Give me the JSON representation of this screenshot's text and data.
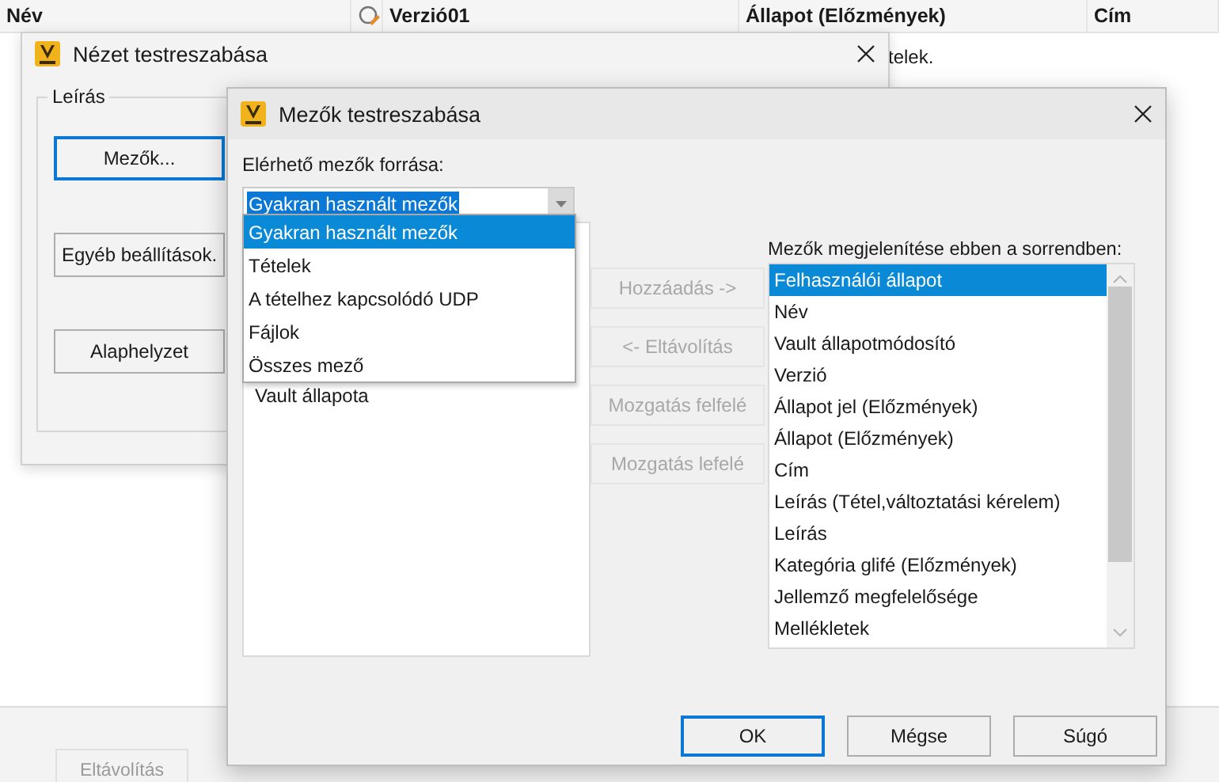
{
  "background": {
    "columns": [
      "Név",
      "Verzió01",
      "Állapot (Előzmények)",
      "Cím"
    ],
    "row_text": "telek.",
    "remove_button": {
      "label": "Eltávolítás",
      "disabled": true
    }
  },
  "view_dialog": {
    "title": "Nézet testreszabása",
    "group_label": "Leírás",
    "buttons": [
      {
        "label": "Mezők...",
        "focused": true
      },
      {
        "label": "Egyéb beállítások.",
        "focused": false
      },
      {
        "label": "Alaphelyzet",
        "focused": false
      }
    ]
  },
  "fields_dialog": {
    "title": "Mezők testreszabása",
    "source_label": "Elérhető mezők forrása:",
    "source_value": "Gyakran használt mezők",
    "dropdown_options": [
      {
        "label": "Gyakran használt mezők",
        "selected": true
      },
      {
        "label": "Tételek",
        "selected": false
      },
      {
        "label": "A tételhez kapcsolódó UDP",
        "selected": false
      },
      {
        "label": "Fájlok",
        "selected": false
      },
      {
        "label": "Összes mező",
        "selected": false
      }
    ],
    "available_fields": [
      "Vault állapota"
    ],
    "middle_buttons": [
      {
        "label": "Hozzáadás ->",
        "disabled": true
      },
      {
        "label": "<- Eltávolítás",
        "disabled": true
      },
      {
        "label": "Mozgatás felfelé",
        "disabled": true
      },
      {
        "label": "Mozgatás lefelé",
        "disabled": true
      }
    ],
    "order_label": "Mezők megjelenítése ebben a sorrendben:",
    "shown_fields": [
      {
        "label": "Felhasználói állapot",
        "selected": true
      },
      {
        "label": "Név",
        "selected": false
      },
      {
        "label": "Vault állapotmódosító",
        "selected": false
      },
      {
        "label": "Verzió",
        "selected": false
      },
      {
        "label": "Állapot jel (Előzmények)",
        "selected": false
      },
      {
        "label": "Állapot (Előzmények)",
        "selected": false
      },
      {
        "label": "Cím",
        "selected": false
      },
      {
        "label": "Leírás (Tétel,változtatási kérelem)",
        "selected": false
      },
      {
        "label": "Leírás",
        "selected": false
      },
      {
        "label": "Kategória glifé (Előzmények)",
        "selected": false
      },
      {
        "label": "Jellemző megfelelősége",
        "selected": false
      },
      {
        "label": "Mellékletek",
        "selected": false
      }
    ],
    "buttons": [
      {
        "label": "OK",
        "default": true
      },
      {
        "label": "Mégse",
        "default": false
      },
      {
        "label": "Súgó",
        "default": false
      }
    ]
  }
}
